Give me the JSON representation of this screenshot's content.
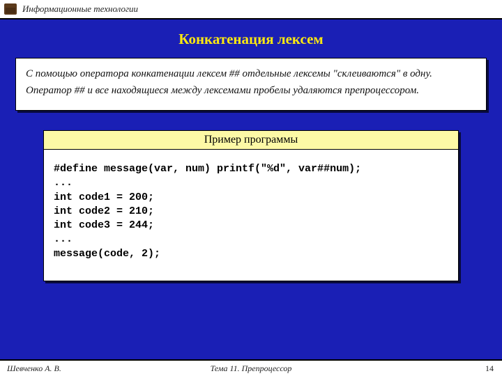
{
  "header": {
    "course": "Информационные технологии"
  },
  "title": "Конкатенация лексем",
  "description": "С помощью оператора конкатенации лексем ## отдельные лексемы \"склеиваются\" в одну. Оператор ## и все находящиеся между лексемами пробелы удаляются препроцессором.",
  "example": {
    "header": "Пример программы",
    "code": "#define message(var, num) printf(\"%d\", var##num);\n...\nint code1 = 200;\nint code2 = 210;\nint code3 = 244;\n...\nmessage(code, 2);"
  },
  "footer": {
    "author": "Шевченко А. В.",
    "topic": "Тема 11. Препроцессор",
    "page": "14"
  }
}
